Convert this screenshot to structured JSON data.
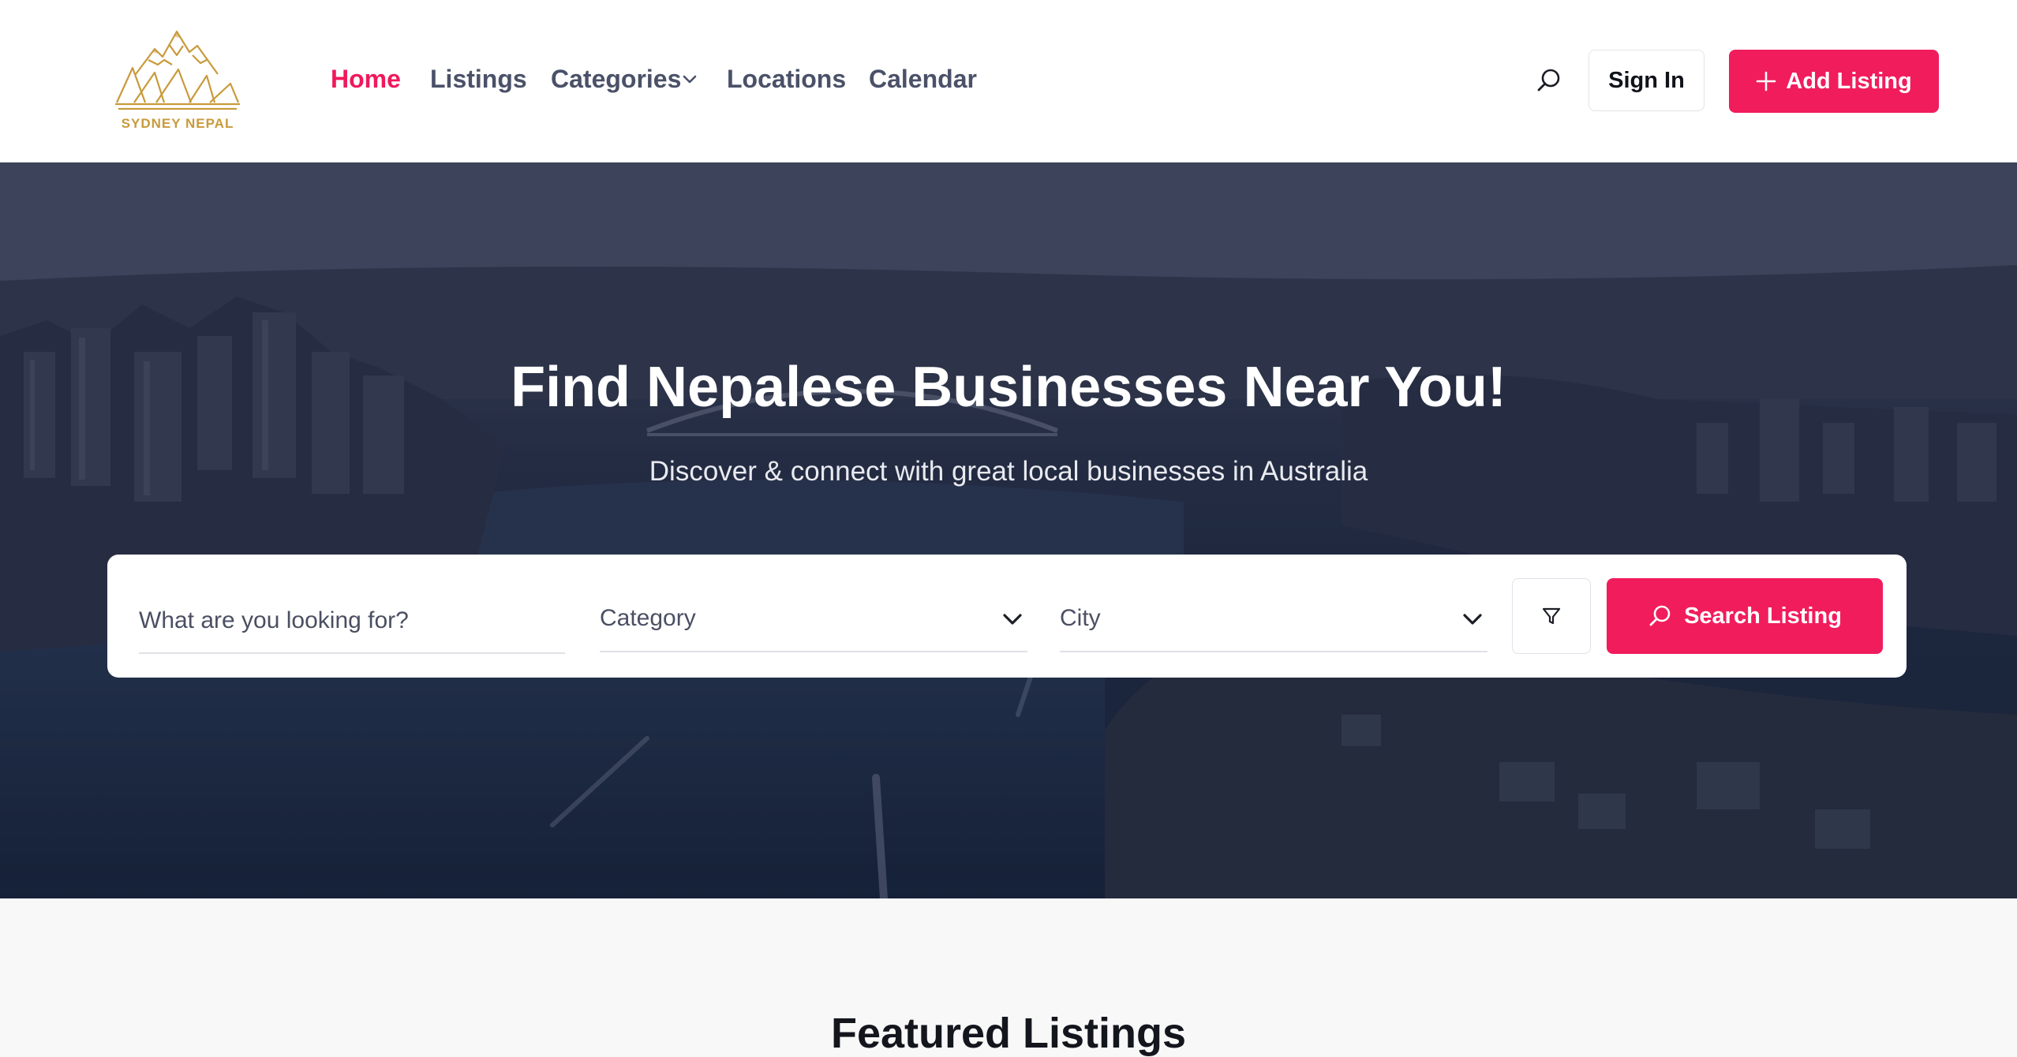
{
  "brand": {
    "name": "SYDNEY NEPAL",
    "logo_color": "#c99a3c"
  },
  "nav": {
    "items": [
      {
        "label": "Home",
        "active": true
      },
      {
        "label": "Listings"
      },
      {
        "label": "Categories",
        "has_dropdown": true
      },
      {
        "label": "Locations"
      },
      {
        "label": "Calendar"
      }
    ]
  },
  "header": {
    "search_icon": "search-icon",
    "signin_label": "Sign In",
    "add_listing_label": "Add Listing",
    "accent_color": "#f11c5c"
  },
  "hero": {
    "title": "Find Nepalese Businesses Near You!",
    "subtitle": "Discover & connect with great local businesses in Australia"
  },
  "search": {
    "keyword_placeholder": "What are you looking for?",
    "category_label": "Category",
    "city_label": "City",
    "filter_icon": "filter-icon",
    "submit_label": "Search Listing"
  },
  "featured": {
    "title": "Featured Listings"
  }
}
